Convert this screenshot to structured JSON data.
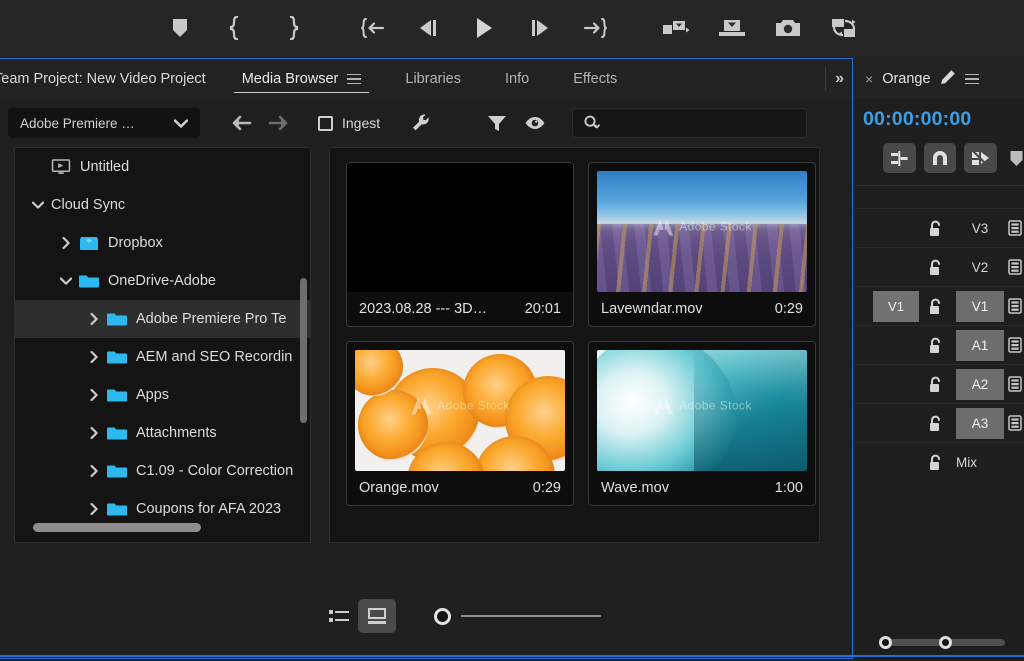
{
  "transport": {
    "buttons": [
      {
        "name": "add-marker-icon",
        "label": "Add Marker"
      },
      {
        "name": "mark-in-icon",
        "label": "Mark In"
      },
      {
        "name": "mark-out-icon",
        "label": "Mark Out"
      },
      {
        "name": "go-to-in-icon",
        "label": "Go to In"
      },
      {
        "name": "step-back-icon",
        "label": "Step Back 1 Frame"
      },
      {
        "name": "play-icon",
        "label": "Play-Stop Toggle"
      },
      {
        "name": "step-forward-icon",
        "label": "Step Forward 1 Frame"
      },
      {
        "name": "go-to-out-icon",
        "label": "Go to Out"
      },
      {
        "name": "insert-icon",
        "label": "Insert"
      },
      {
        "name": "overwrite-icon",
        "label": "Overwrite"
      },
      {
        "name": "export-frame-icon",
        "label": "Export Frame"
      },
      {
        "name": "comparison-view-icon",
        "label": "Comparison View"
      }
    ]
  },
  "panel": {
    "project_title": "Team Project: New Video Project",
    "tabs": [
      {
        "label": "Media Browser",
        "active": true,
        "has_menu": true
      },
      {
        "label": "Libraries",
        "active": false,
        "has_menu": false
      },
      {
        "label": "Info",
        "active": false,
        "has_menu": false
      },
      {
        "label": "Effects",
        "active": false,
        "has_menu": false
      }
    ],
    "overflow_label": "»"
  },
  "browser_toolbar": {
    "drive_selected": "Adobe Premiere …",
    "drive_chevron": "chevron-down-icon",
    "back_label": "Back",
    "forward_label": "Forward",
    "ingest_label": "Ingest",
    "ingest_checked": false,
    "wrench_label": "Ingest Settings",
    "filter_label": "Filter",
    "eye_label": "Preview Toggle",
    "search_value": "",
    "search_placeholder": ""
  },
  "tree": {
    "items": [
      {
        "label": "Untitled",
        "indent": 0,
        "arrow": "",
        "icon": "monitor",
        "selected": false
      },
      {
        "label": "Cloud Sync",
        "indent": 0,
        "arrow": "v",
        "icon": "none",
        "selected": false
      },
      {
        "label": "Dropbox",
        "indent": 1,
        "arrow": ">",
        "icon": "dropbox",
        "selected": false
      },
      {
        "label": "OneDrive-Adobe",
        "indent": 1,
        "arrow": "v",
        "icon": "folder",
        "selected": false
      },
      {
        "label": "Adobe Premiere Pro Te",
        "indent": 2,
        "arrow": ">",
        "icon": "folder",
        "selected": true
      },
      {
        "label": "AEM and SEO Recordin",
        "indent": 2,
        "arrow": ">",
        "icon": "folder",
        "selected": false
      },
      {
        "label": "Apps",
        "indent": 2,
        "arrow": ">",
        "icon": "folder",
        "selected": false
      },
      {
        "label": "Attachments",
        "indent": 2,
        "arrow": ">",
        "icon": "folder",
        "selected": false
      },
      {
        "label": "C1.09 - Color Correction",
        "indent": 2,
        "arrow": ">",
        "icon": "folder",
        "selected": false
      },
      {
        "label": "Coupons for AFA 2023",
        "indent": 2,
        "arrow": ">",
        "icon": "folder",
        "selected": false
      }
    ]
  },
  "media": {
    "items": [
      {
        "name": "2023.08.28 --- 3D…",
        "duration": "20:01",
        "thumb": "none",
        "watermark": false
      },
      {
        "name": "Lavewndar.mov",
        "duration": "0:29",
        "thumb": "lavender",
        "watermark": true,
        "watermark_text": "Adobe Stock"
      },
      {
        "name": "Orange.mov",
        "duration": "0:29",
        "thumb": "orange",
        "watermark": true,
        "watermark_text": "Adobe Stock"
      },
      {
        "name": "Wave.mov",
        "duration": "1:00",
        "thumb": "wave",
        "watermark": true,
        "watermark_text": "Adobe Stock"
      }
    ]
  },
  "browser_footer": {
    "list_view_label": "List View",
    "icon_view_label": "Icon View",
    "icon_view_active": true,
    "zoom_value": 0
  },
  "timeline": {
    "close_label": "×",
    "sequence_name": "Orange",
    "pencil_label": "Edit",
    "menu_label": "Panel Menu",
    "timecode": "00:00:00:00",
    "tools": [
      {
        "name": "align-to-sequence-icon",
        "label": "Align To Sequence"
      },
      {
        "name": "snap-magnet-icon",
        "label": "Snap In Timeline"
      },
      {
        "name": "linked-selection-icon",
        "label": "Linked Selection"
      }
    ],
    "marker_label": "Add Marker",
    "tracks": [
      {
        "track": "V3",
        "source": "",
        "lit": false,
        "lock": "unlocked",
        "sync": true
      },
      {
        "track": "V2",
        "source": "",
        "lit": false,
        "lock": "unlocked",
        "sync": true
      },
      {
        "track": "V1",
        "source": "V1",
        "lit": true,
        "lock": "unlocked",
        "sync": true
      },
      {
        "track": "A1",
        "source": "",
        "lit": true,
        "lock": "unlocked",
        "sync": true
      },
      {
        "track": "A2",
        "source": "",
        "lit": true,
        "lock": "unlocked",
        "sync": true
      },
      {
        "track": "A3",
        "source": "",
        "lit": true,
        "lock": "unlocked",
        "sync": true
      }
    ],
    "mix_label": "Mix"
  },
  "colors": {
    "accent_blue": "#3b9fe8",
    "focus_border": "#2a6ed4",
    "panel_bg": "#1f1f1f",
    "tab_bg": "#222222",
    "folder_blue": "#2eb8f0",
    "track_chip": "#6d6d6d"
  }
}
